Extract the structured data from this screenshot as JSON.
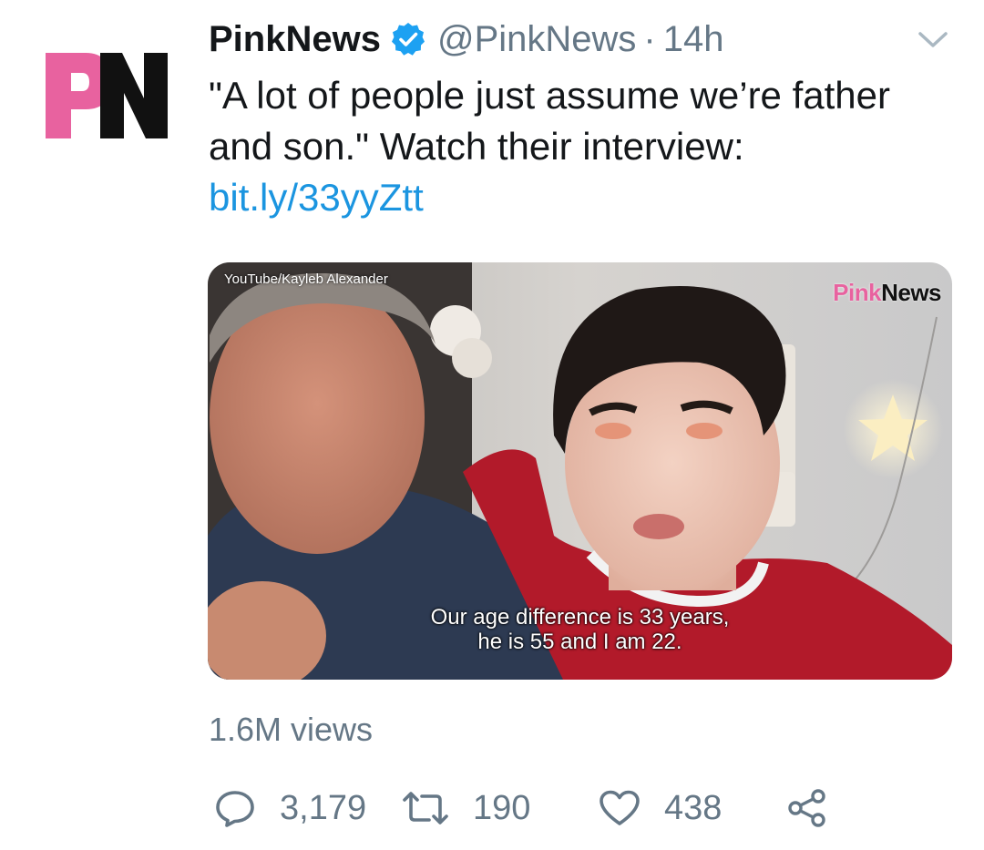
{
  "account": {
    "display_name": "PinkNews",
    "handle": "@PinkNews",
    "separator": "·",
    "time": "14h",
    "verified": true,
    "avatar_text": "PN",
    "avatar_colors": {
      "p": "#e8629f",
      "n": "#111111"
    }
  },
  "menu": {
    "icon": "chevron-down-icon"
  },
  "tweet": {
    "text": "\"A lot of people just assume we’re father and son.\" Watch their interview: ",
    "link": "bit.ly/33yyZtt",
    "link_color": "#1b95e0"
  },
  "media": {
    "credit": "YouTube/Kayleb Alexander",
    "logo_pink": "Pink",
    "logo_dark": "News",
    "subtitle_line1": "Our age difference is 33 years,",
    "subtitle_line2": "he is 55 and I am 22."
  },
  "stats": {
    "views": "1.6M views"
  },
  "actions": {
    "reply": {
      "icon": "reply-icon",
      "count": "3,179"
    },
    "retweet": {
      "icon": "retweet-icon",
      "count": "190"
    },
    "like": {
      "icon": "heart-icon",
      "count": "438"
    },
    "share": {
      "icon": "share-icon"
    }
  },
  "colors": {
    "secondary_text": "#657786",
    "verified": "#1da1f2"
  }
}
